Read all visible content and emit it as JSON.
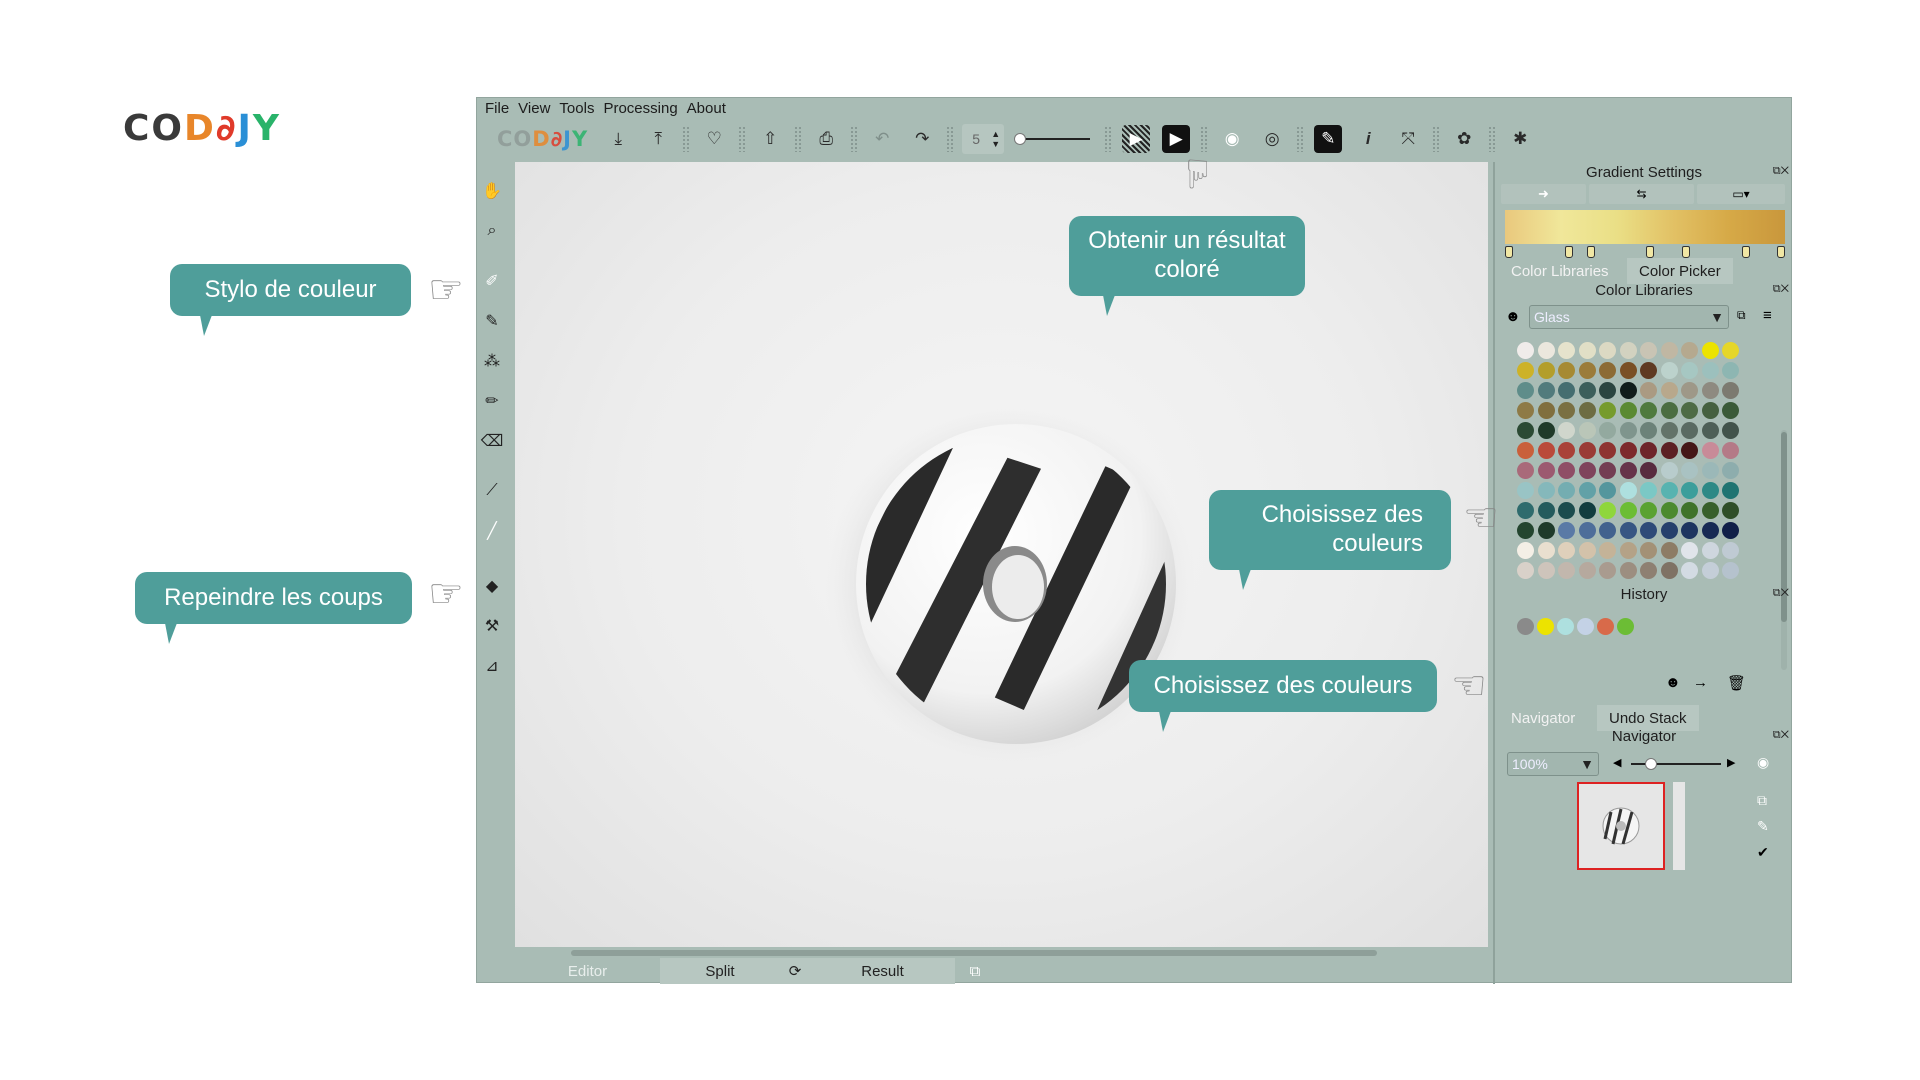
{
  "logo": {
    "letters": [
      "C",
      "O",
      "D",
      "∂",
      "J",
      "Y"
    ],
    "colors": [
      "#3a3a3a",
      "#3a3a3a",
      "#e8862a",
      "#e03a2a",
      "#2a8fd6",
      "#29b36a"
    ]
  },
  "menu": [
    "File",
    "View",
    "Tools",
    "Processing",
    "About"
  ],
  "toolbar": {
    "logo_letters": [
      "C",
      "O",
      "D",
      "∂",
      "J",
      "Y"
    ],
    "logo_colors": [
      "#8e9b97",
      "#8e9b97",
      "#e8862a",
      "#e03a2a",
      "#2a8fd6",
      "#29b36a"
    ],
    "brush_size": "5",
    "icons": [
      "open-icon",
      "save-icon",
      "import-icon",
      "upload-icon",
      "print-icon",
      "undo-icon",
      "redo-icon",
      "brush-size-spinner",
      "brush-size-slider",
      "preview-icon",
      "run-icon",
      "eye-icon",
      "eye-hidden-icon",
      "pen-mode-icon",
      "info-icon",
      "fullscreen-icon",
      "settings-icon",
      "bug-icon"
    ]
  },
  "tools": [
    "hand-icon",
    "zoom-icon",
    "color-pen-icon",
    "brush-icon",
    "spray-icon",
    "marker-icon",
    "eraser-icon",
    "line-icon",
    "thin-brush-icon",
    "fill-icon",
    "hammer-icon",
    "eyedropper-icon"
  ],
  "bottom_tabs": {
    "editor": "Editor",
    "split": "Split",
    "result": "Result"
  },
  "gradient": {
    "title": "Gradient Settings",
    "colors": [
      "#e9c87d",
      "#f0e79a",
      "#eadf86",
      "#e2c165",
      "#d6a947",
      "#c9973c"
    ]
  },
  "color_tabs": {
    "libraries": "Color Libraries",
    "picker": "Color Picker"
  },
  "color_libraries": {
    "title": "Color Libraries",
    "selected_library": "Glass",
    "swatches": [
      [
        "#f0ecea",
        "#ebe7dd",
        "#e6e3cc",
        "#e1dfc6",
        "#dcd9c3",
        "#d2d2c0",
        "#c9c4b4",
        "#c0b7a3",
        "#b5a98f",
        "#ece300",
        "#e5d62a"
      ],
      [
        "#cdb228",
        "#b39e2b",
        "#a68a33",
        "#9b7c3a",
        "#8c6b35",
        "#7a5026",
        "#5f3a22",
        "#bcd2cc",
        "#a6c7c2",
        "#9cc0bd",
        "#8db6b2"
      ],
      [
        "#5f8d8a",
        "#517b7c",
        "#456e70",
        "#3c5f5b",
        "#2b4540",
        "#111d1b",
        "#aa9a82",
        "#b8a88c",
        "#9e9888",
        "#8e8a80",
        "#7c7a70"
      ],
      [
        "#8e7a46",
        "#806f3e",
        "#7a7042",
        "#6d6d43",
        "#769b2d",
        "#5a8a32",
        "#4f7a3e",
        "#4b6d41",
        "#4e6b45",
        "#45603f",
        "#3a5a38"
      ],
      [
        "#2b4a34",
        "#1f3a29",
        "#d0d6cc",
        "#bac6b8",
        "#93a99f",
        "#7f958d",
        "#6c8279",
        "#637369",
        "#5a6a62",
        "#4e5f57",
        "#42534b"
      ],
      [
        "#c9603b",
        "#ba4a3a",
        "#a94239",
        "#9a3b36",
        "#8e3431",
        "#7d2a2c",
        "#6e252a",
        "#5c2024",
        "#451717",
        "#c88b98",
        "#b47a87"
      ],
      [
        "#a96a7a",
        "#9c5a70",
        "#8f4e66",
        "#7f445c",
        "#733e53",
        "#66344a",
        "#582c3f",
        "#b8cccc",
        "#a9c2c2",
        "#9bb8b8",
        "#8dadad"
      ],
      [
        "#99c4c5",
        "#85b8bb",
        "#74adb1",
        "#62a1a7",
        "#54969d",
        "#aee0df",
        "#7bc8c5",
        "#58b3b0",
        "#3c9e9b",
        "#2d8986",
        "#1f7472"
      ],
      [
        "#2e6b6d",
        "#245b5d",
        "#1b4c4e",
        "#123d3f",
        "#8fd63c",
        "#6cbd35",
        "#5aa231",
        "#4c8a2e",
        "#3f732a",
        "#375f2b",
        "#2f4e28"
      ],
      [
        "#23452f",
        "#1e3a2a",
        "#5a7aa6",
        "#4e6e9a",
        "#42628e",
        "#385683",
        "#2f4b78",
        "#26406c",
        "#1e3560",
        "#172a54",
        "#101f48"
      ],
      [
        "#f4efe6",
        "#e9dfcf",
        "#dfd0bb",
        "#d3c2aa",
        "#c4b398",
        "#b4a287",
        "#a39176",
        "#8d7c65",
        "#e0e4ea",
        "#ced6de",
        "#bfcad3"
      ],
      [
        "#d9d1c9",
        "#cec4bb",
        "#c2b7ad",
        "#b6a99e",
        "#a99b8f",
        "#9c8e80",
        "#8e8072",
        "#7f7264",
        "#d3dbe3",
        "#c4ced8",
        "#b5c2cd"
      ]
    ]
  },
  "history": {
    "title": "History",
    "colors": [
      "#8a8a8a",
      "#ece300",
      "#aee0df",
      "#c4d2e6",
      "#d86a4a",
      "#6cbd35"
    ]
  },
  "navigator": {
    "tab_navigator": "Navigator",
    "tab_undo": "Undo Stack",
    "title": "Navigator",
    "zoom": "100%"
  },
  "callouts": {
    "result": "Obtenir un résultat coloré",
    "pen": "Stylo de couleur",
    "repaint": "Repeindre les coups",
    "choose1": "Choisissez des couleurs",
    "choose2": "Choisissez des couleurs"
  }
}
